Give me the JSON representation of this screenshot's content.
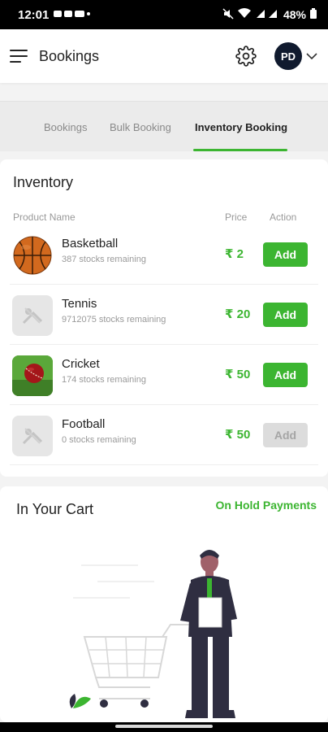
{
  "status_bar": {
    "time": "12:01",
    "battery": "48%"
  },
  "app_bar": {
    "title": "Bookings",
    "avatar_initials": "PD"
  },
  "tabs": [
    {
      "label": "Bookings",
      "active": false
    },
    {
      "label": "Bulk Booking",
      "active": false
    },
    {
      "label": "Inventory Booking",
      "active": true
    }
  ],
  "inventory": {
    "title": "Inventory",
    "columns": {
      "product": "Product Name",
      "price": "Price",
      "action": "Action"
    },
    "items": [
      {
        "name": "Basketball",
        "stock": "387 stocks remaining",
        "price": "₹ 2",
        "action": "Add",
        "enabled": true,
        "icon": "basketball-icon"
      },
      {
        "name": "Tennis",
        "stock": "9712075 stocks remaining",
        "price": "₹ 20",
        "action": "Add",
        "enabled": true,
        "icon": "placeholder-image-icon"
      },
      {
        "name": "Cricket",
        "stock": "174 stocks remaining",
        "price": "₹ 50",
        "action": "Add",
        "enabled": true,
        "icon": "cricket-ball-icon"
      },
      {
        "name": "Football",
        "stock": "0 stocks remaining",
        "price": "₹ 50",
        "action": "Add",
        "enabled": false,
        "icon": "placeholder-image-icon"
      }
    ]
  },
  "cart": {
    "title": "In Your Cart",
    "on_hold_label": "On Hold Payments"
  },
  "colors": {
    "accent": "#3cb531",
    "avatar_bg": "#101a2e",
    "disabled_btn": "#dcdcdc"
  }
}
